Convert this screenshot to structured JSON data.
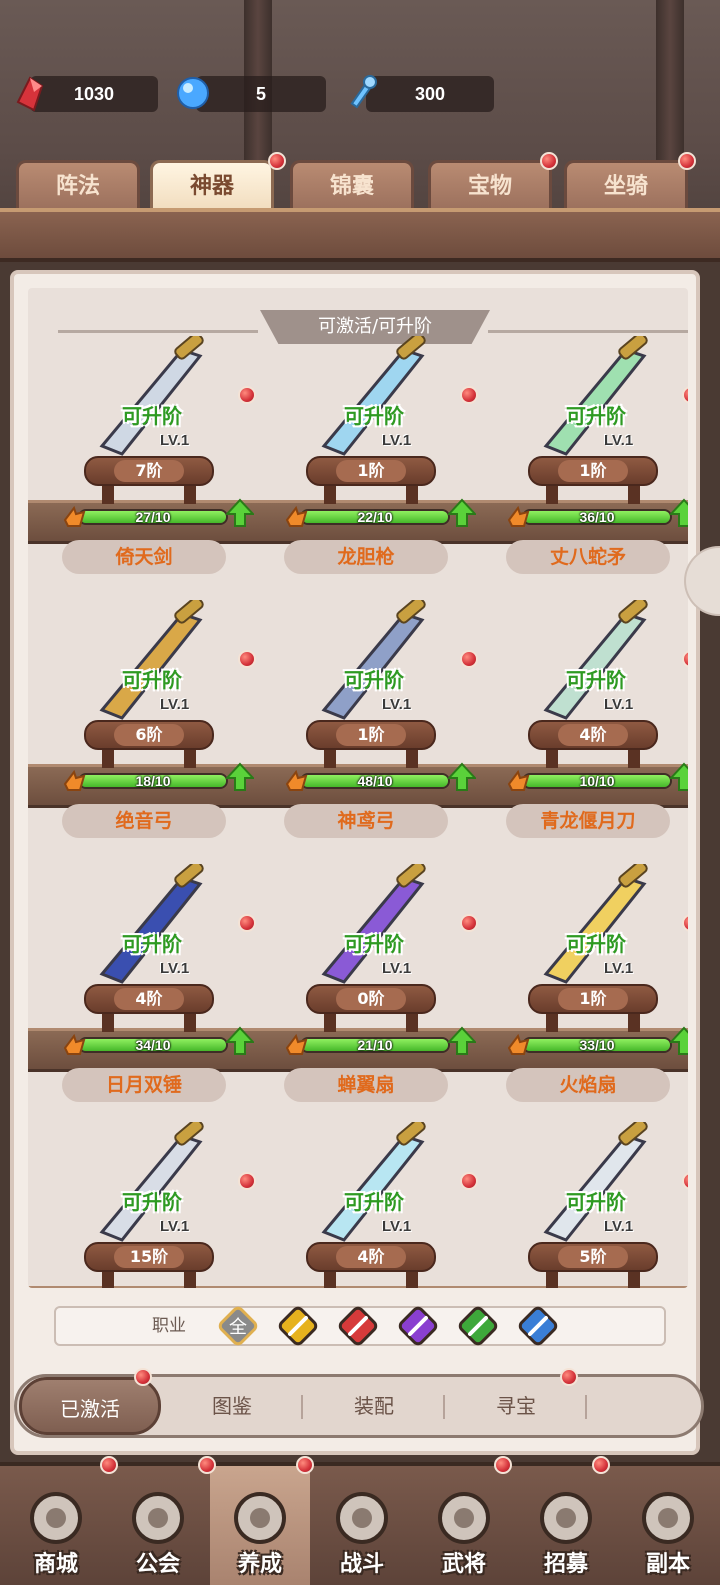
{
  "resources": [
    {
      "name": "red-crystal",
      "value": "1030"
    },
    {
      "name": "blue-orb",
      "value": "5"
    },
    {
      "name": "key",
      "value": "300"
    }
  ],
  "tabs": [
    {
      "label": "阵法",
      "active": false,
      "dot": false
    },
    {
      "label": "神器",
      "active": true,
      "dot": true
    },
    {
      "label": "锦囊",
      "active": false,
      "dot": false
    },
    {
      "label": "宝物",
      "active": false,
      "dot": true
    },
    {
      "label": "坐骑",
      "active": false,
      "dot": true
    }
  ],
  "section_title": "可激活/可升阶",
  "upgrade_label": "可升阶",
  "level_label": "LV.1",
  "items": [
    {
      "name": "倚天剑",
      "rank": "7阶",
      "progress": "27/10",
      "icon": "sword-icon"
    },
    {
      "name": "龙胆枪",
      "rank": "1阶",
      "progress": "22/10",
      "icon": "spear-icon"
    },
    {
      "name": "丈八蛇矛",
      "rank": "1阶",
      "progress": "36/10",
      "icon": "serpent-spear-icon"
    },
    {
      "name": "绝音弓",
      "rank": "6阶",
      "progress": "18/10",
      "icon": "bow-icon"
    },
    {
      "name": "神鸢弓",
      "rank": "1阶",
      "progress": "48/10",
      "icon": "crossbow-icon"
    },
    {
      "name": "青龙偃月刀",
      "rank": "4阶",
      "progress": "10/10",
      "icon": "glaive-icon"
    },
    {
      "name": "日月双锤",
      "rank": "4阶",
      "progress": "34/10",
      "icon": "hammer-icon"
    },
    {
      "name": "蝉翼扇",
      "rank": "0阶",
      "progress": "21/10",
      "icon": "purple-fan-icon"
    },
    {
      "name": "火焰扇",
      "rank": "1阶",
      "progress": "33/10",
      "icon": "golden-fan-icon"
    },
    {
      "name": "",
      "rank": "15阶",
      "progress": "",
      "icon": "dagger-icon"
    },
    {
      "name": "",
      "rank": "4阶",
      "progress": "",
      "icon": "long-spear-icon"
    },
    {
      "name": "",
      "rank": "5阶",
      "progress": "",
      "icon": "halberd-icon"
    }
  ],
  "filter": {
    "label": "职业",
    "all_label": "全",
    "classes": [
      {
        "icon": "all-class-icon",
        "color": "#8a8a8a"
      },
      {
        "icon": "sword-class-icon",
        "color": "#e6b21e"
      },
      {
        "icon": "blade-class-icon",
        "color": "#d63a3a"
      },
      {
        "icon": "bow-class-icon",
        "color": "#8a3fd0"
      },
      {
        "icon": "spear-class-icon",
        "color": "#3ea83a"
      },
      {
        "icon": "healer-class-icon",
        "color": "#3a7ed6"
      }
    ]
  },
  "subtabs": [
    {
      "label": "已激活",
      "active": true
    },
    {
      "label": "图鉴",
      "active": false
    },
    {
      "label": "装配",
      "active": false
    },
    {
      "label": "寻宝",
      "active": false
    }
  ],
  "nav": [
    {
      "label": "商城",
      "icon": "shop-icon"
    },
    {
      "label": "公会",
      "icon": "guild-icon"
    },
    {
      "label": "养成",
      "icon": "nurture-icon",
      "active": true
    },
    {
      "label": "战斗",
      "icon": "battle-icon"
    },
    {
      "label": "武将",
      "icon": "general-icon"
    },
    {
      "label": "招募",
      "icon": "recruit-icon"
    },
    {
      "label": "副本",
      "icon": "dungeon-icon"
    }
  ],
  "colors": {
    "accent_orange": "#e06a1d",
    "upgrade_green": "#2e9a22",
    "notify_red": "#d4323a"
  }
}
